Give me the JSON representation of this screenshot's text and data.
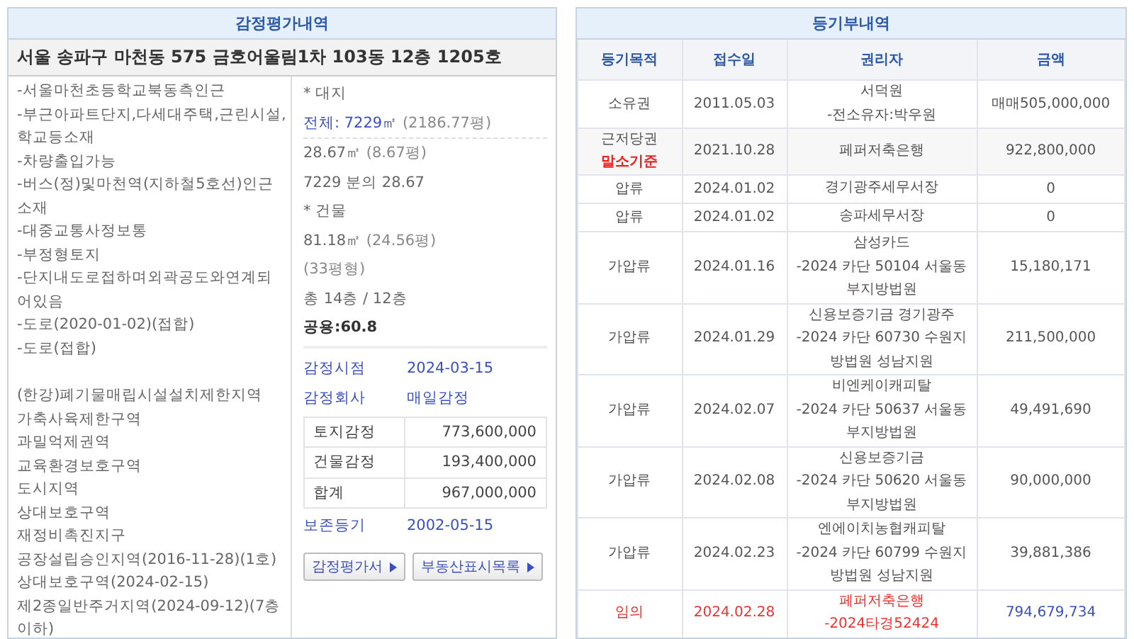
{
  "appraisal": {
    "title": "감정평가내역",
    "address": "서울 송파구 마천동 575 금호어울림1차 103동 12층 1205호",
    "notes": [
      "-서울마천초등학교북동측인근",
      "-부근아파트단지,다세대주택,근린시설,학교등소재",
      "-차량출입가능",
      "-버스(정)및마천역(지하철5호선)인근소재",
      "-대중교통사정보통",
      "-부정형토지",
      "-단지내도로접하며외곽공도와연계되어있음",
      "-도로(2020-01-02)(접합)",
      "-도로(접합)"
    ],
    "zones": [
      "(한강)폐기물매립시설설치제한지역",
      "가축사육제한구역",
      "과밀억제권역",
      "교육환경보호구역",
      "도시지역",
      "상대보호구역",
      "재정비촉진지구",
      "공장설립승인지역(2016-11-28)(1호)",
      "상대보호구역(2024-02-15)",
      "제2종일반주거지역(2024-09-12)(7층이하)"
    ],
    "land_heading": "* 대지",
    "land_total_label": "전체: 7229㎡",
    "land_total_pyeong": "(2186.77평)",
    "land_area": "28.67㎡",
    "land_area_pyeong": "(8.67평)",
    "land_share": "7229 분의 28.67",
    "building_heading": "* 건물",
    "building_area": "81.18㎡",
    "building_area_pyeong": "(24.56평)",
    "building_type": "(33평형)",
    "floors": "총 14층 / 12층",
    "common": "공용:60.8",
    "info": [
      {
        "label": "감정시점",
        "value": "2024-03-15"
      },
      {
        "label": "감정회사",
        "value": "매일감정"
      }
    ],
    "values": [
      {
        "label": "토지감정",
        "value": "773,600,000"
      },
      {
        "label": "건물감정",
        "value": "193,400,000"
      },
      {
        "label": "합계",
        "value": "967,000,000"
      }
    ],
    "preservation": {
      "label": "보존등기",
      "value": "2002-05-15"
    },
    "buttons": [
      "감정평가서",
      "부동산표시목록"
    ]
  },
  "registry": {
    "title": "등기부내역",
    "columns": [
      "등기목적",
      "접수일",
      "권리자",
      "금액"
    ],
    "rows": [
      {
        "kind": "normal",
        "purpose": "소유권",
        "date": "2011.05.03",
        "holder": [
          "서덕원",
          "-전소유자:박우원"
        ],
        "amount": "매매505,000,000"
      },
      {
        "kind": "base",
        "purpose": "근저당권",
        "note": "말소기준",
        "date": "2021.10.28",
        "holder": [
          "페퍼저축은행"
        ],
        "amount": "922,800,000"
      },
      {
        "kind": "normal",
        "purpose": "압류",
        "date": "2024.01.02",
        "holder": [
          "경기광주세무서장"
        ],
        "amount": "0"
      },
      {
        "kind": "normal",
        "purpose": "압류",
        "date": "2024.01.02",
        "holder": [
          "송파세무서장"
        ],
        "amount": "0"
      },
      {
        "kind": "normal",
        "purpose": "가압류",
        "date": "2024.01.16",
        "holder": [
          "삼성카드",
          "-2024 카단 50104 서울동부지방법원"
        ],
        "amount": "15,180,171"
      },
      {
        "kind": "normal",
        "purpose": "가압류",
        "date": "2024.01.29",
        "holder": [
          "신용보증기금 경기광주",
          "-2024 카단 60730 수원지방법원 성남지원"
        ],
        "amount": "211,500,000"
      },
      {
        "kind": "normal",
        "purpose": "가압류",
        "date": "2024.02.07",
        "holder": [
          "비엔케이캐피탈",
          "-2024 카단 50637 서울동부지방법원"
        ],
        "amount": "49,491,690"
      },
      {
        "kind": "normal",
        "purpose": "가압류",
        "date": "2024.02.08",
        "holder": [
          "신용보증기금",
          "-2024 카단 50620 서울동부지방법원"
        ],
        "amount": "90,000,000"
      },
      {
        "kind": "normal",
        "purpose": "가압류",
        "date": "2024.02.23",
        "holder": [
          "엔에이치농협캐피탈",
          "-2024 카단 60799 수원지방법원 성남지원"
        ],
        "amount": "39,881,386"
      },
      {
        "kind": "auction",
        "purpose": "임의",
        "date": "2024.02.28",
        "holder": [
          "페퍼저축은행",
          "-2024타경52424"
        ],
        "amount": "794,679,734"
      }
    ]
  }
}
